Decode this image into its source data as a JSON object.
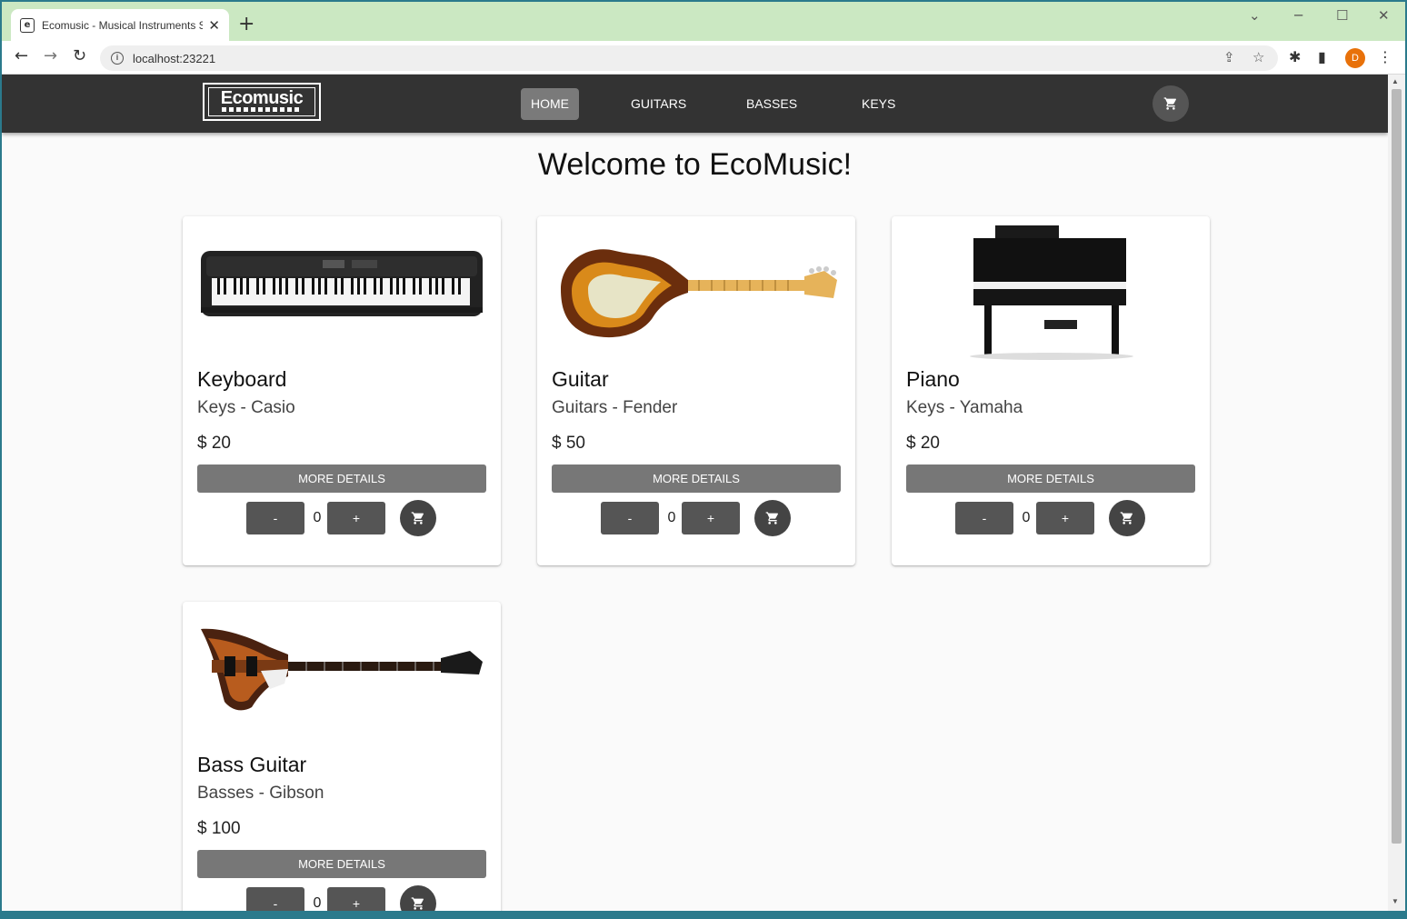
{
  "browser": {
    "tab_title": "Ecomusic - Musical Instruments S",
    "favicon": "e",
    "url": "localhost:23221",
    "profile_initial": "D"
  },
  "app": {
    "logo_text": "Ecomusic",
    "nav": [
      {
        "label": "HOME",
        "active": true
      },
      {
        "label": "GUITARS",
        "active": false
      },
      {
        "label": "BASSES",
        "active": false
      },
      {
        "label": "KEYS",
        "active": false
      }
    ],
    "welcome": "Welcome to EcoMusic!"
  },
  "products": [
    {
      "title": "Keyboard",
      "subtitle": "Keys - Casio",
      "price": "$ 20",
      "details_label": "MORE DETAILS",
      "minus": "-",
      "qty": "0",
      "plus": "+",
      "image": "keyboard"
    },
    {
      "title": "Guitar",
      "subtitle": "Guitars - Fender",
      "price": "$ 50",
      "details_label": "MORE DETAILS",
      "minus": "-",
      "qty": "0",
      "plus": "+",
      "image": "guitar"
    },
    {
      "title": "Piano",
      "subtitle": "Keys - Yamaha",
      "price": "$ 20",
      "details_label": "MORE DETAILS",
      "minus": "-",
      "qty": "0",
      "plus": "+",
      "image": "piano"
    },
    {
      "title": "Bass Guitar",
      "subtitle": "Basses - Gibson",
      "price": "$ 100",
      "details_label": "MORE DETAILS",
      "minus": "-",
      "qty": "0",
      "plus": "+",
      "image": "bass"
    }
  ],
  "colors": {
    "appbar": "#333333",
    "active_nav": "#7a7a7a",
    "details_button": "#777777",
    "qty_button": "#555555",
    "chrome_frame": "#cbe8c2"
  }
}
